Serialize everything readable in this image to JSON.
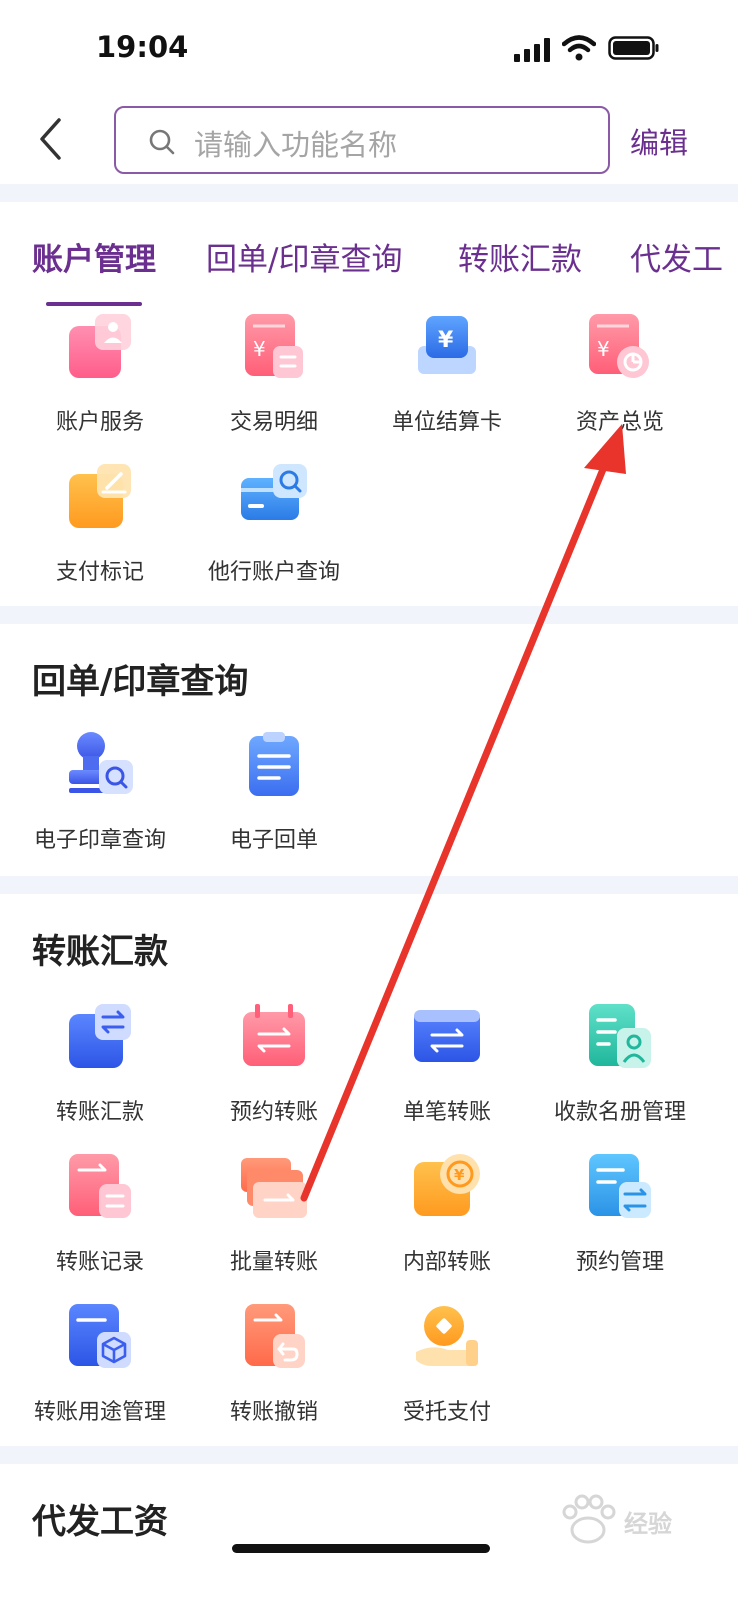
{
  "status": {
    "time": "19:04"
  },
  "search": {
    "placeholder": "请输入功能名称"
  },
  "header": {
    "edit_label": "编辑"
  },
  "tabs": [
    {
      "label": "账户管理",
      "active": true
    },
    {
      "label": "回单/印章查询",
      "active": false
    },
    {
      "label": "转账汇款",
      "active": false
    },
    {
      "label": "代发工",
      "active": false
    }
  ],
  "account_items": [
    {
      "label": "账户服务",
      "icon": "account-service-icon"
    },
    {
      "label": "交易明细",
      "icon": "transaction-detail-icon"
    },
    {
      "label": "单位结算卡",
      "icon": "settlement-card-icon"
    },
    {
      "label": "资产总览",
      "icon": "asset-overview-icon"
    },
    {
      "label": "支付标记",
      "icon": "payment-mark-icon"
    },
    {
      "label": "他行账户查询",
      "icon": "other-bank-query-icon"
    }
  ],
  "receipt_section": {
    "title": "回单/印章查询",
    "items": [
      {
        "label": "电子印章查询",
        "icon": "e-seal-query-icon"
      },
      {
        "label": "电子回单",
        "icon": "e-receipt-icon"
      }
    ]
  },
  "transfer_section": {
    "title": "转账汇款",
    "items": [
      {
        "label": "转账汇款",
        "icon": "transfer-remit-icon"
      },
      {
        "label": "预约转账",
        "icon": "scheduled-transfer-icon"
      },
      {
        "label": "单笔转账",
        "icon": "single-transfer-icon"
      },
      {
        "label": "收款名册管理",
        "icon": "payee-list-icon"
      },
      {
        "label": "转账记录",
        "icon": "transfer-record-icon"
      },
      {
        "label": "批量转账",
        "icon": "batch-transfer-icon"
      },
      {
        "label": "内部转账",
        "icon": "internal-transfer-icon"
      },
      {
        "label": "预约管理",
        "icon": "schedule-manage-icon"
      },
      {
        "label": "转账用途管理",
        "icon": "transfer-purpose-icon"
      },
      {
        "label": "转账撤销",
        "icon": "transfer-revoke-icon"
      },
      {
        "label": "受托支付",
        "icon": "entrusted-payment-icon"
      }
    ]
  },
  "payroll_section": {
    "title": "代发工资"
  },
  "watermark": {
    "text": "经验"
  },
  "colors": {
    "accent": "#6b2f8f",
    "arrow": "#e8342b",
    "page_bg": "#f1f4fb"
  }
}
